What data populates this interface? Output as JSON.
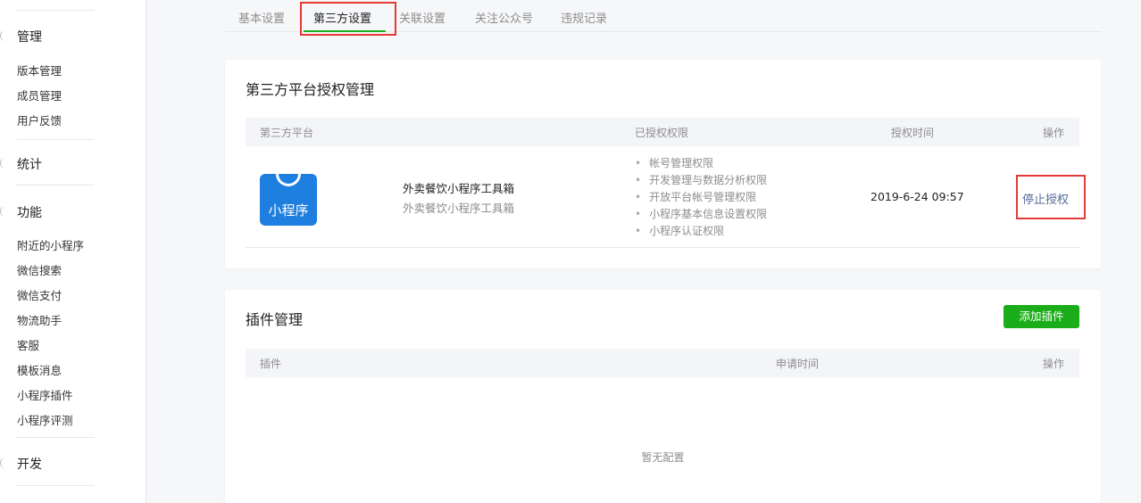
{
  "sidebar": {
    "groups": [
      {
        "label": "管理",
        "items": [
          "版本管理",
          "成员管理",
          "用户反馈"
        ]
      },
      {
        "label": "统计",
        "items": []
      },
      {
        "label": "功能",
        "items": [
          "附近的小程序",
          "微信搜索",
          "微信支付",
          "物流助手",
          "客服",
          "模板消息",
          "小程序插件",
          "小程序评测"
        ]
      },
      {
        "label": "开发",
        "items": []
      }
    ]
  },
  "tabs": [
    "基本设置",
    "第三方设置",
    "关联设置",
    "关注公众号",
    "违规记录"
  ],
  "active_tab": "第三方设置",
  "auth_section": {
    "title": "第三方平台授权管理",
    "columns": [
      "第三方平台",
      "已授权权限",
      "授权时间",
      "操作"
    ],
    "row": {
      "icon_text": "小程序",
      "name": "外卖餐饮小程序工具箱",
      "subtitle": "外卖餐饮小程序工具箱",
      "permissions": [
        "帐号管理权限",
        "开发管理与数据分析权限",
        "开放平台帐号管理权限",
        "小程序基本信息设置权限",
        "小程序认证权限"
      ],
      "time": "2019-6-24 09:57",
      "action": "停止授权"
    }
  },
  "plugin_section": {
    "title": "插件管理",
    "add_button": "添加插件",
    "columns": [
      "插件",
      "申请时间",
      "操作"
    ],
    "empty_text": "暂无配置"
  },
  "colors": {
    "accent": "#1aad19",
    "link": "#576b95",
    "highlight": "#e53935",
    "icon_blue": "#1e7fe0"
  }
}
